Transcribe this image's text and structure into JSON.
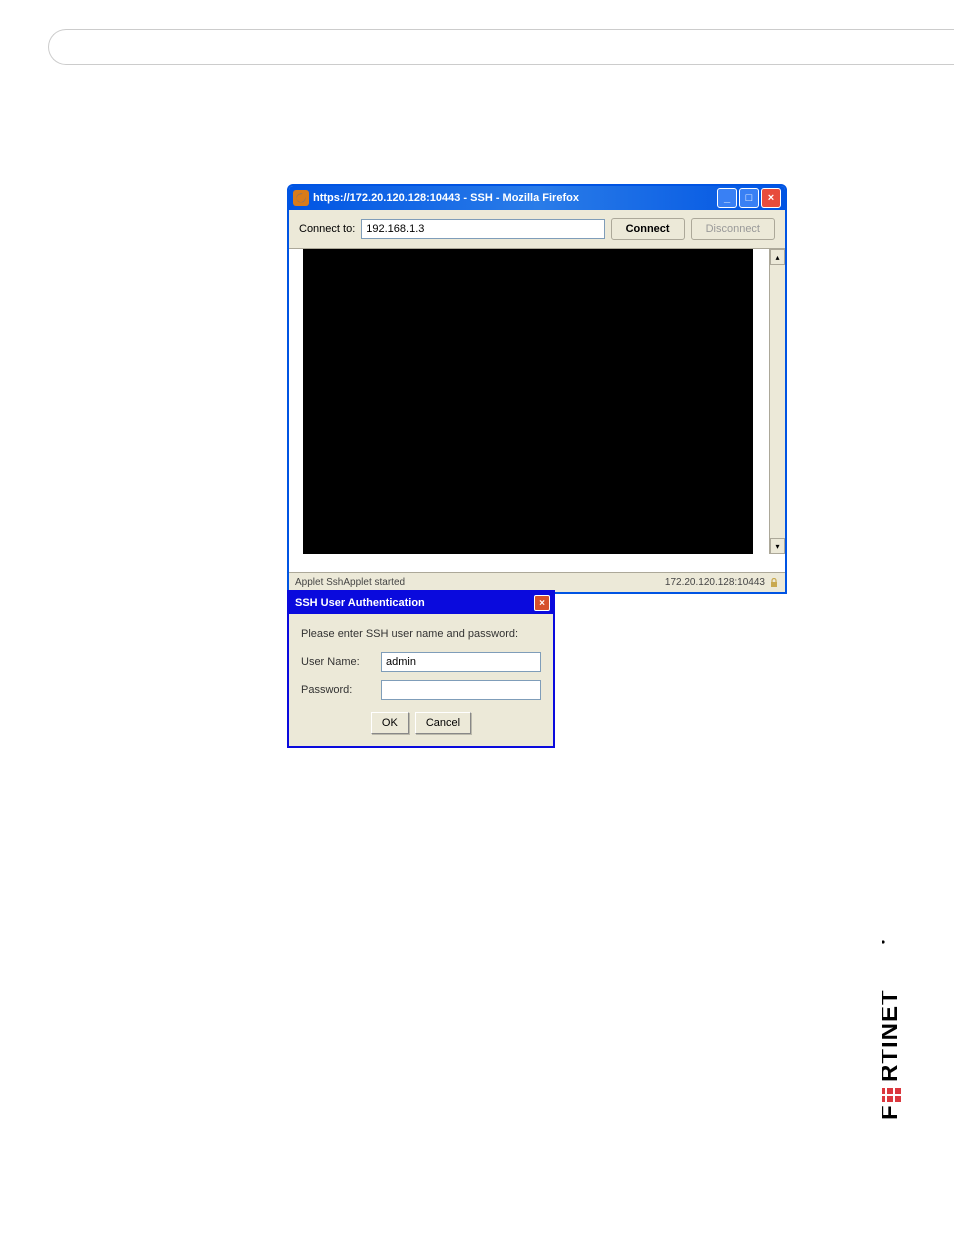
{
  "browser": {
    "title": "https://172.20.120.128:10443 - SSH - Mozilla Firefox",
    "toolbar": {
      "connect_to_label": "Connect to:",
      "connect_to_value": "192.168.1.3",
      "connect_button": "Connect",
      "disconnect_button": "Disconnect"
    },
    "status": {
      "left": "Applet SshApplet started",
      "right": "172.20.120.128:10443"
    }
  },
  "auth_dialog": {
    "title": "SSH User Authentication",
    "prompt": "Please enter SSH user name and password:",
    "username_label": "User Name:",
    "username_value": "admin",
    "password_label": "Password:",
    "password_value": "",
    "ok_button": "OK",
    "cancel_button": "Cancel"
  }
}
